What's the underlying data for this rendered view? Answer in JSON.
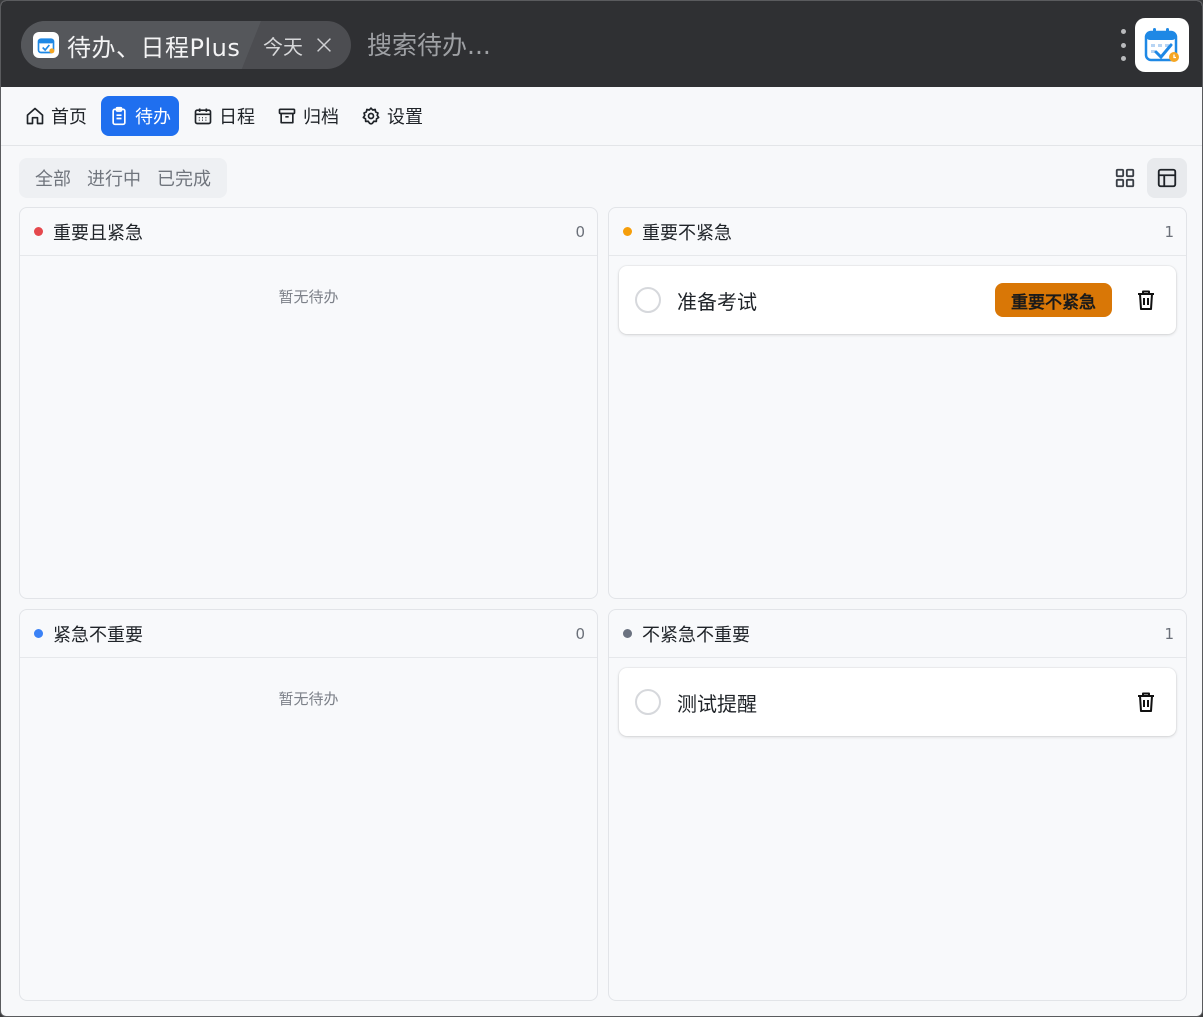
{
  "titlebar": {
    "app_name": "待办、日程Plus",
    "tag": "今天",
    "search_placeholder": "搜索待办..."
  },
  "nav": [
    {
      "label": "首页",
      "icon": "home-icon",
      "active": false
    },
    {
      "label": "待办",
      "icon": "clipboard-icon",
      "active": true
    },
    {
      "label": "日程",
      "icon": "calendar-icon",
      "active": false
    },
    {
      "label": "归档",
      "icon": "archive-icon",
      "active": false
    },
    {
      "label": "设置",
      "icon": "gear-icon",
      "active": false
    }
  ],
  "filters": [
    "全部",
    "进行中",
    "已完成"
  ],
  "views": [
    {
      "icon": "grid-icon",
      "active": false
    },
    {
      "icon": "table-layout-icon",
      "active": true
    }
  ],
  "colors": {
    "accent": "#1f6fef",
    "urgent_important": "#e5484d",
    "important": "#f59e0b",
    "urgent": "#3b82f6",
    "neither": "#6b7280",
    "badge": "#d97706"
  },
  "quadrants": [
    {
      "title": "重要且紧急",
      "count": "0",
      "empty_text": "暂无待办",
      "tasks": []
    },
    {
      "title": "重要不紧急",
      "count": "1",
      "empty_text": "",
      "tasks": [
        {
          "title": "准备考试",
          "badge": "重要不紧急"
        }
      ]
    },
    {
      "title": "紧急不重要",
      "count": "0",
      "empty_text": "暂无待办",
      "tasks": []
    },
    {
      "title": "不紧急不重要",
      "count": "1",
      "empty_text": "",
      "tasks": [
        {
          "title": "测试提醒",
          "badge": ""
        }
      ]
    }
  ]
}
